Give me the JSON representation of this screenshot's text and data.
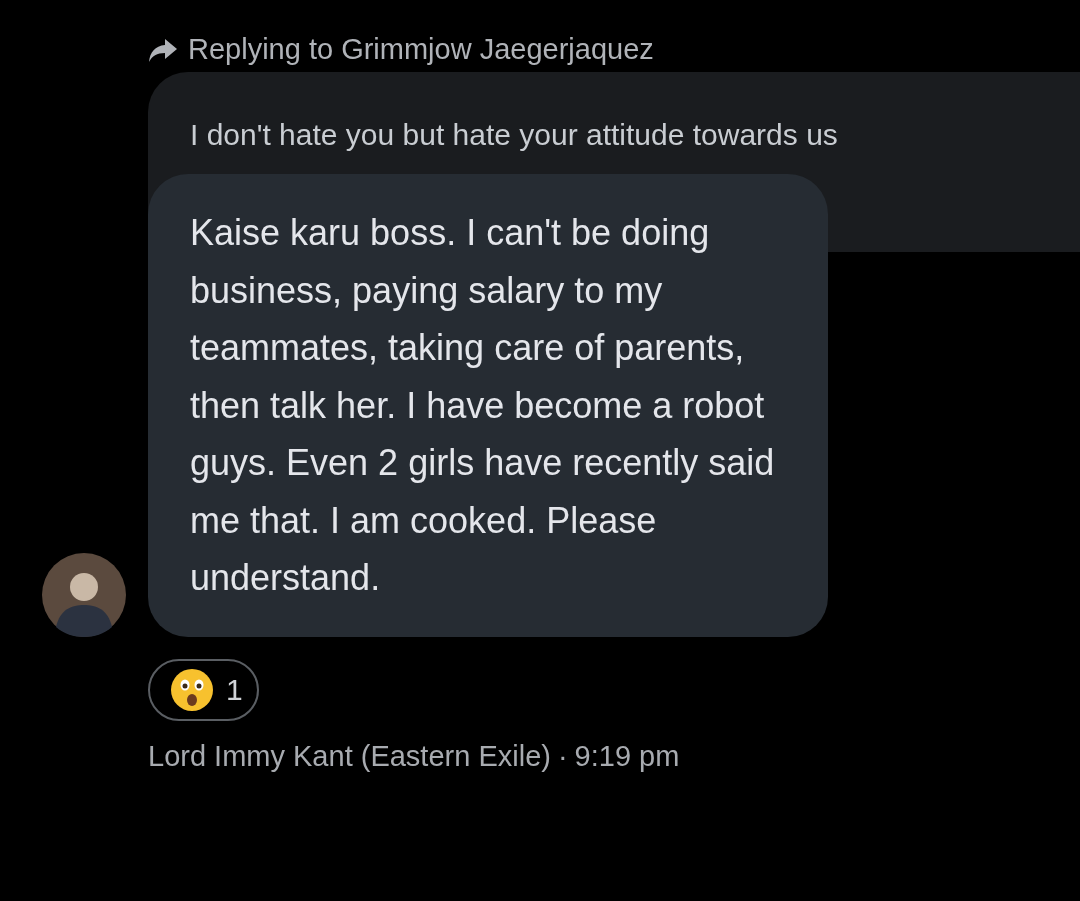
{
  "reply_header": {
    "text": "Replying to Grimmjow Jaegerjaquez"
  },
  "quoted_message": {
    "text": "I don't hate you but hate your attitude towards us"
  },
  "message": {
    "text": "Kaise karu boss. I can't be doing business, paying salary to my teammates, taking care of parents, then talk her. I have become a robot guys. Even 2 girls have recently said me that. I am cooked. Please understand."
  },
  "reactions": [
    {
      "count": "1"
    }
  ],
  "footer": {
    "sender": "Lord Immy Kant (Eastern Exile)",
    "separator": "·",
    "time": "9:19 pm"
  }
}
